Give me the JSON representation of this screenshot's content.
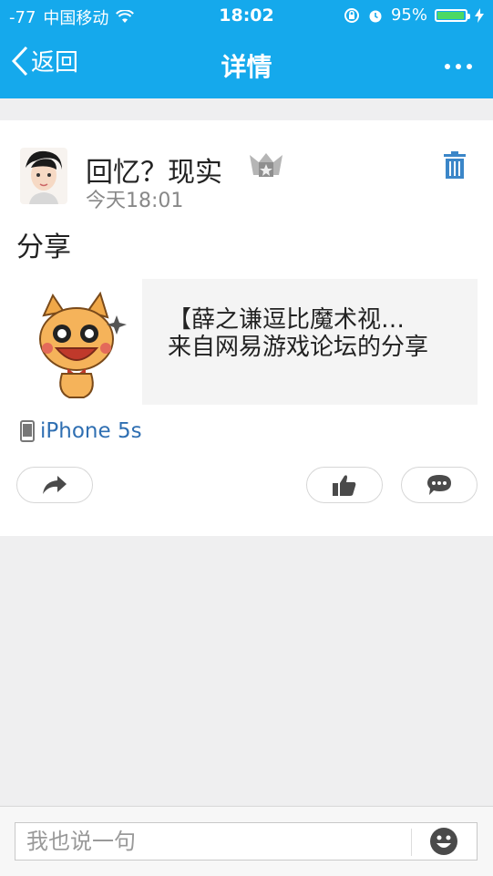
{
  "status_bar": {
    "signal": "-77",
    "carrier": "中国移动",
    "time": "18:02",
    "battery": "95%",
    "battery_level": 0.95
  },
  "nav": {
    "back_label": "返回",
    "title": "详情",
    "more_icon": "ellipsis-icon"
  },
  "post": {
    "author": "回忆？现实",
    "time": "今天18:01",
    "text": "分享",
    "share": {
      "title": "【薛之谦逗比魔术视…",
      "description": "来自网易游戏论坛的分享"
    },
    "device": "iPhone 5s"
  },
  "comment_box": {
    "placeholder": "我也说一句"
  },
  "colors": {
    "header": "#15a9ec",
    "link": "#2f6fb2",
    "trash": "#3b86c8"
  }
}
